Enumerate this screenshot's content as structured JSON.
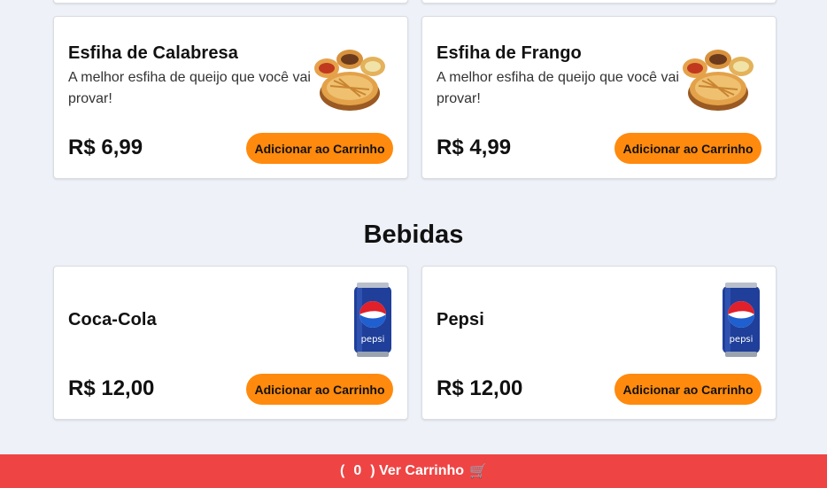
{
  "categories": [
    {
      "title": "",
      "items": [
        {
          "name": "Esfiha de Calabresa",
          "description": "A melhor esfiha de queijo que você vai provar!",
          "price": "R$ 6,99",
          "button": "Adicionar ao Carrinho",
          "image": "esfiha-plate-image"
        },
        {
          "name": "Esfiha de Frango",
          "description": "A melhor esfiha de queijo que você vai provar!",
          "price": "R$ 4,99",
          "button": "Adicionar ao Carrinho",
          "image": "esfiha-plate-image"
        }
      ]
    },
    {
      "title": "Bebidas",
      "items": [
        {
          "name": "Coca-Cola",
          "description": "",
          "price": "R$ 12,00",
          "button": "Adicionar ao Carrinho",
          "image": "pepsi-can-image"
        },
        {
          "name": "Pepsi",
          "description": "",
          "price": "R$ 12,00",
          "button": "Adicionar ao Carrinho",
          "image": "pepsi-can-image"
        }
      ]
    }
  ],
  "cart": {
    "open_paren": "(",
    "count": "0",
    "close_label": ") Ver Carrinho",
    "icon": "🛒"
  },
  "colors": {
    "background": "#eef2f8",
    "button": "#ff8a0d",
    "cart_bar": "#ef4444"
  }
}
